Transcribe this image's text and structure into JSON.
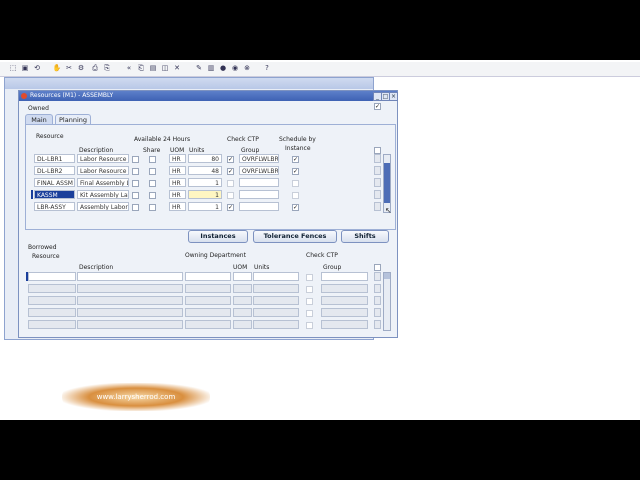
{
  "window": {
    "title": "Resources (M1) - ASSEMBLY",
    "owned_label": "Owned"
  },
  "tabs": [
    {
      "label": "Main"
    },
    {
      "label": "Planning"
    }
  ],
  "resource_table": {
    "headers": {
      "resource": "Resource",
      "description": "Description",
      "available_24": "Available 24 Hours",
      "share": "Share",
      "uom": "UOM",
      "units": "Units",
      "check_ctp": "Check CTP",
      "group": "Group",
      "schedule_by": "Schedule by",
      "instance": "Instance"
    },
    "rows": [
      {
        "resource": "DL-LBR1",
        "description": "Labor Resource -",
        "avail": false,
        "share": false,
        "uom": "HR",
        "units": "80",
        "check_ctp": true,
        "group": "OVRFLWLBR",
        "schedule": true
      },
      {
        "resource": "DL-LBR2",
        "description": "Labor Resource -",
        "avail": false,
        "share": false,
        "uom": "HR",
        "units": "48",
        "check_ctp": true,
        "group": "OVRFLWLBR",
        "schedule": true
      },
      {
        "resource": "FINAL ASSM",
        "description": "Final Assembly L",
        "avail": false,
        "share": false,
        "uom": "HR",
        "units": "1",
        "check_ctp": false,
        "group": "",
        "schedule": false
      },
      {
        "resource": "KASSM",
        "description": "Kit Assembly Lat",
        "avail": false,
        "share": false,
        "uom": "HR",
        "units": "1",
        "check_ctp": false,
        "group": "",
        "schedule": false
      },
      {
        "resource": "LBR-ASSY",
        "description": "Assembly Labor",
        "avail": false,
        "share": false,
        "uom": "HR",
        "units": "1",
        "check_ctp": true,
        "group": "",
        "schedule": true
      }
    ]
  },
  "buttons": {
    "instances": "Instances",
    "tolerance": "Tolerance Fences",
    "shifts": "Shifts"
  },
  "borrowed": {
    "title": "Borrowed",
    "headers": {
      "resource": "Resource",
      "description": "Description",
      "owning_department": "Owning Department",
      "uom": "UOM",
      "units": "Units",
      "check_ctp": "Check CTP",
      "group": "Group"
    }
  },
  "watermark": "www.larrysherrod.com"
}
